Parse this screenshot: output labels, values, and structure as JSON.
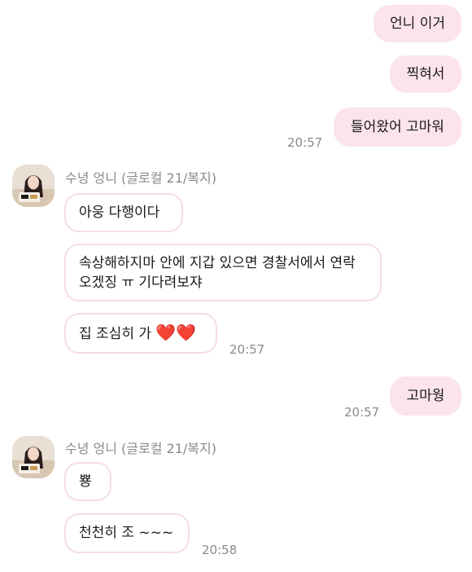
{
  "chat": {
    "sender_name": "수녕 엉니 (글로컬 21/복지)",
    "outgoing": [
      {
        "text": "언니 이거"
      },
      {
        "text": "찍혀서"
      },
      {
        "text": "들어왔어 고마워"
      },
      {
        "text": "고마웡"
      }
    ],
    "incoming_1": [
      {
        "text": "아웅 다행이다"
      },
      {
        "line1": "속상해하지마 안에 지갑 있으면 경찰서에서 연락",
        "line2": "오겠징 ㅠ 기다려보쟈"
      },
      {
        "text": "집 조심히 가",
        "emoji": "❤️❤️"
      }
    ],
    "incoming_2": [
      {
        "text": "뿅"
      },
      {
        "text": "천천히 조 ~~~"
      }
    ],
    "times": {
      "t1": "20:57",
      "t2": "20:57",
      "t3": "20:57",
      "t4": "20:58"
    }
  },
  "colors": {
    "outgoing_bubble": "#fbe4ea",
    "incoming_border": "#f6dde4",
    "timestamp": "#8a8a8a"
  }
}
